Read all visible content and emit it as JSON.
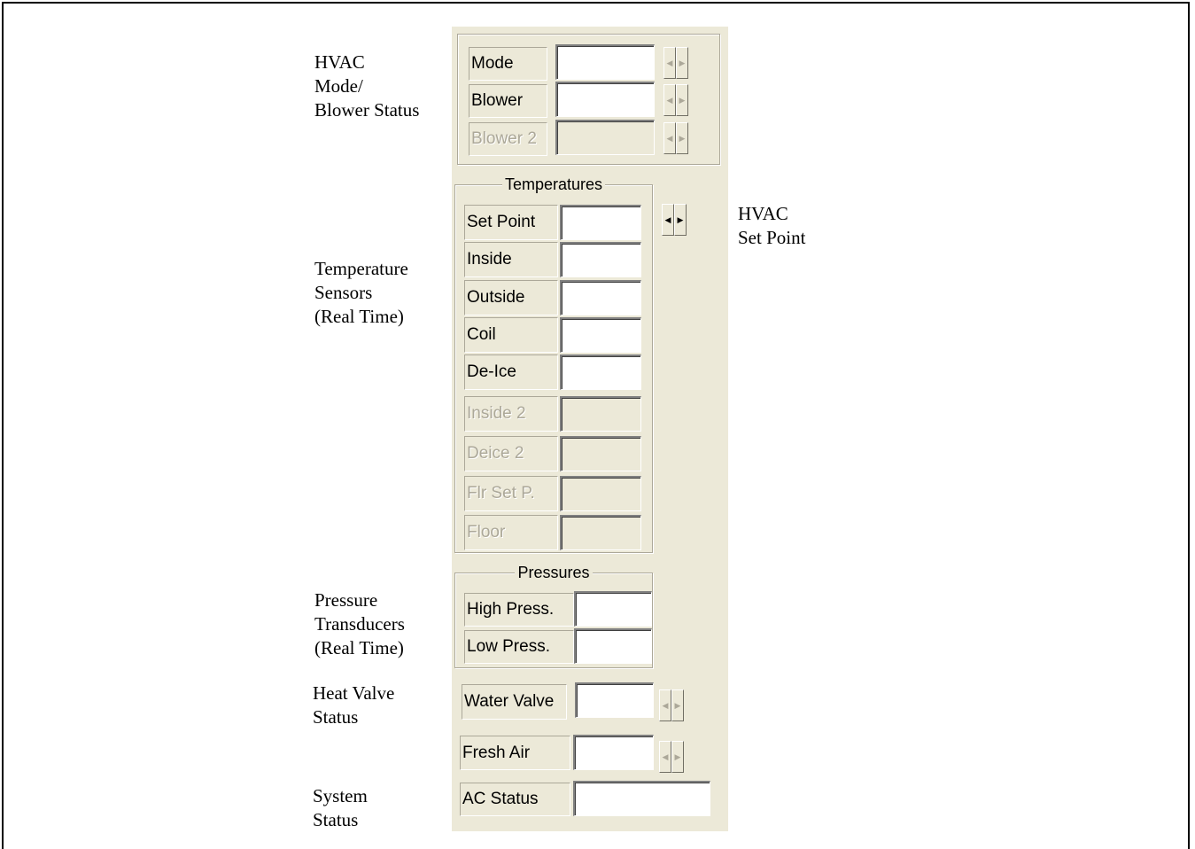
{
  "annotations": {
    "hvac_mode": "HVAC\nMode/\nBlower Status",
    "temperature": "Temperature\nSensors\n(Real Time)",
    "set_point": "HVAC\nSet Point",
    "pressure": "Pressure\nTransducers\n(Real Time)",
    "heat_valve": "Heat Valve\nStatus",
    "system": "System\nStatus"
  },
  "mode_group": {
    "rows": [
      {
        "label": "Mode",
        "enabled": true
      },
      {
        "label": "Blower",
        "enabled": true
      },
      {
        "label": "Blower 2",
        "enabled": false
      }
    ]
  },
  "temperatures": {
    "title": "Temperatures",
    "rows": [
      {
        "label": "Set Point",
        "enabled": true
      },
      {
        "label": "Inside",
        "enabled": true
      },
      {
        "label": "Outside",
        "enabled": true
      },
      {
        "label": "Coil",
        "enabled": true
      },
      {
        "label": "De-Ice",
        "enabled": true
      },
      {
        "label": "Inside 2",
        "enabled": false
      },
      {
        "label": "Deice 2",
        "enabled": false
      },
      {
        "label": "Flr Set P.",
        "enabled": false
      },
      {
        "label": "Floor",
        "enabled": false
      }
    ]
  },
  "pressures": {
    "title": "Pressures",
    "rows": [
      {
        "label": "High Press."
      },
      {
        "label": "Low Press."
      }
    ]
  },
  "water_valve": {
    "label": "Water Valve"
  },
  "fresh_air": {
    "label": "Fresh Air"
  },
  "ac_status": {
    "label": "AC Status"
  },
  "icons": {
    "left": "◀",
    "right": "▶"
  }
}
